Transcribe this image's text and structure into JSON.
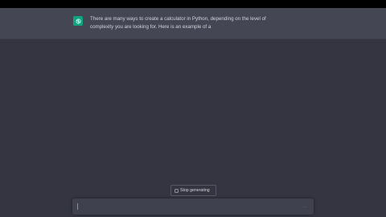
{
  "chat": {
    "assistant_message": "There are many ways to create a calculator in Python, depending on the level of\ncomplexity you are looking for. Here is an example of a"
  },
  "controls": {
    "stop_label": "Stop generating",
    "stop_icon": "stop-square-icon"
  },
  "composer": {
    "value": "",
    "send_icon": "send-icon"
  },
  "colors": {
    "background": "#343541",
    "assistant_row": "#444654",
    "avatar": "#10a37f",
    "input": "#40414f"
  }
}
